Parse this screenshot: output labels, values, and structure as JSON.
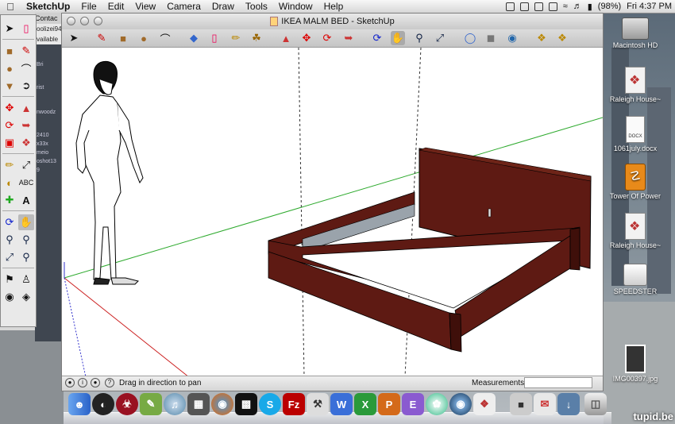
{
  "menubar": {
    "app_name": "SketchUp",
    "items": [
      "File",
      "Edit",
      "View",
      "Camera",
      "Draw",
      "Tools",
      "Window",
      "Help"
    ],
    "battery": "(98%)",
    "clock": "Fri 4:37 PM"
  },
  "background_window": {
    "title": "Contac",
    "line1": "oolizei94",
    "line2": "vailable",
    "strip_items": [
      "Bri",
      "rist",
      "nwoodz",
      "2410",
      "x33x",
      "meio",
      "oshot13",
      "9"
    ]
  },
  "window": {
    "title": "IKEA MALM BED - SketchUp"
  },
  "statusbar": {
    "hint": "Drag in direction to pan",
    "measurements_label": "Measurements",
    "measurements_value": ""
  },
  "desktop_icons": [
    {
      "label": "Macintosh HD",
      "icon": "hard-drive-icon"
    },
    {
      "label": "Raleigh House~",
      "icon": "sketchup-file-icon"
    },
    {
      "label": "1061july.docx",
      "icon": "docx-file-icon"
    },
    {
      "label": "Tower Of Power",
      "icon": "usb-drive-icon"
    },
    {
      "label": "Raleigh House~",
      "icon": "sketchup-file-icon"
    },
    {
      "label": "SPEEDSTER",
      "icon": "external-drive-icon"
    },
    {
      "label": "IMG00397.jpg",
      "icon": "image-file-icon"
    }
  ],
  "dock_apps": [
    "finder-icon",
    "dashboard-icon",
    "front-row-icon",
    "textwrangler-icon",
    "itunes-icon",
    "iphoto-icon",
    "firefox-icon",
    "iterm-icon",
    "skype-icon",
    "filezilla-icon",
    "utility-icon",
    "word-icon",
    "excel-icon",
    "powerpoint-icon",
    "entourage-icon",
    "colorsync-icon",
    "google-earth-icon",
    "sketchup-doc-icon",
    "preview-icon",
    "mail-icon",
    "downloads-icon",
    "trash-icon"
  ],
  "dock_labels": {
    "skype": "S",
    "filezilla": "Fz"
  },
  "watermark": "tupid.be",
  "colors": {
    "bed": "#5e1a13",
    "bed_dark": "#3f0f0a",
    "green_axis": "#2eaa2e",
    "red_axis": "#cc2222",
    "blue_axis": "#3333cc"
  }
}
